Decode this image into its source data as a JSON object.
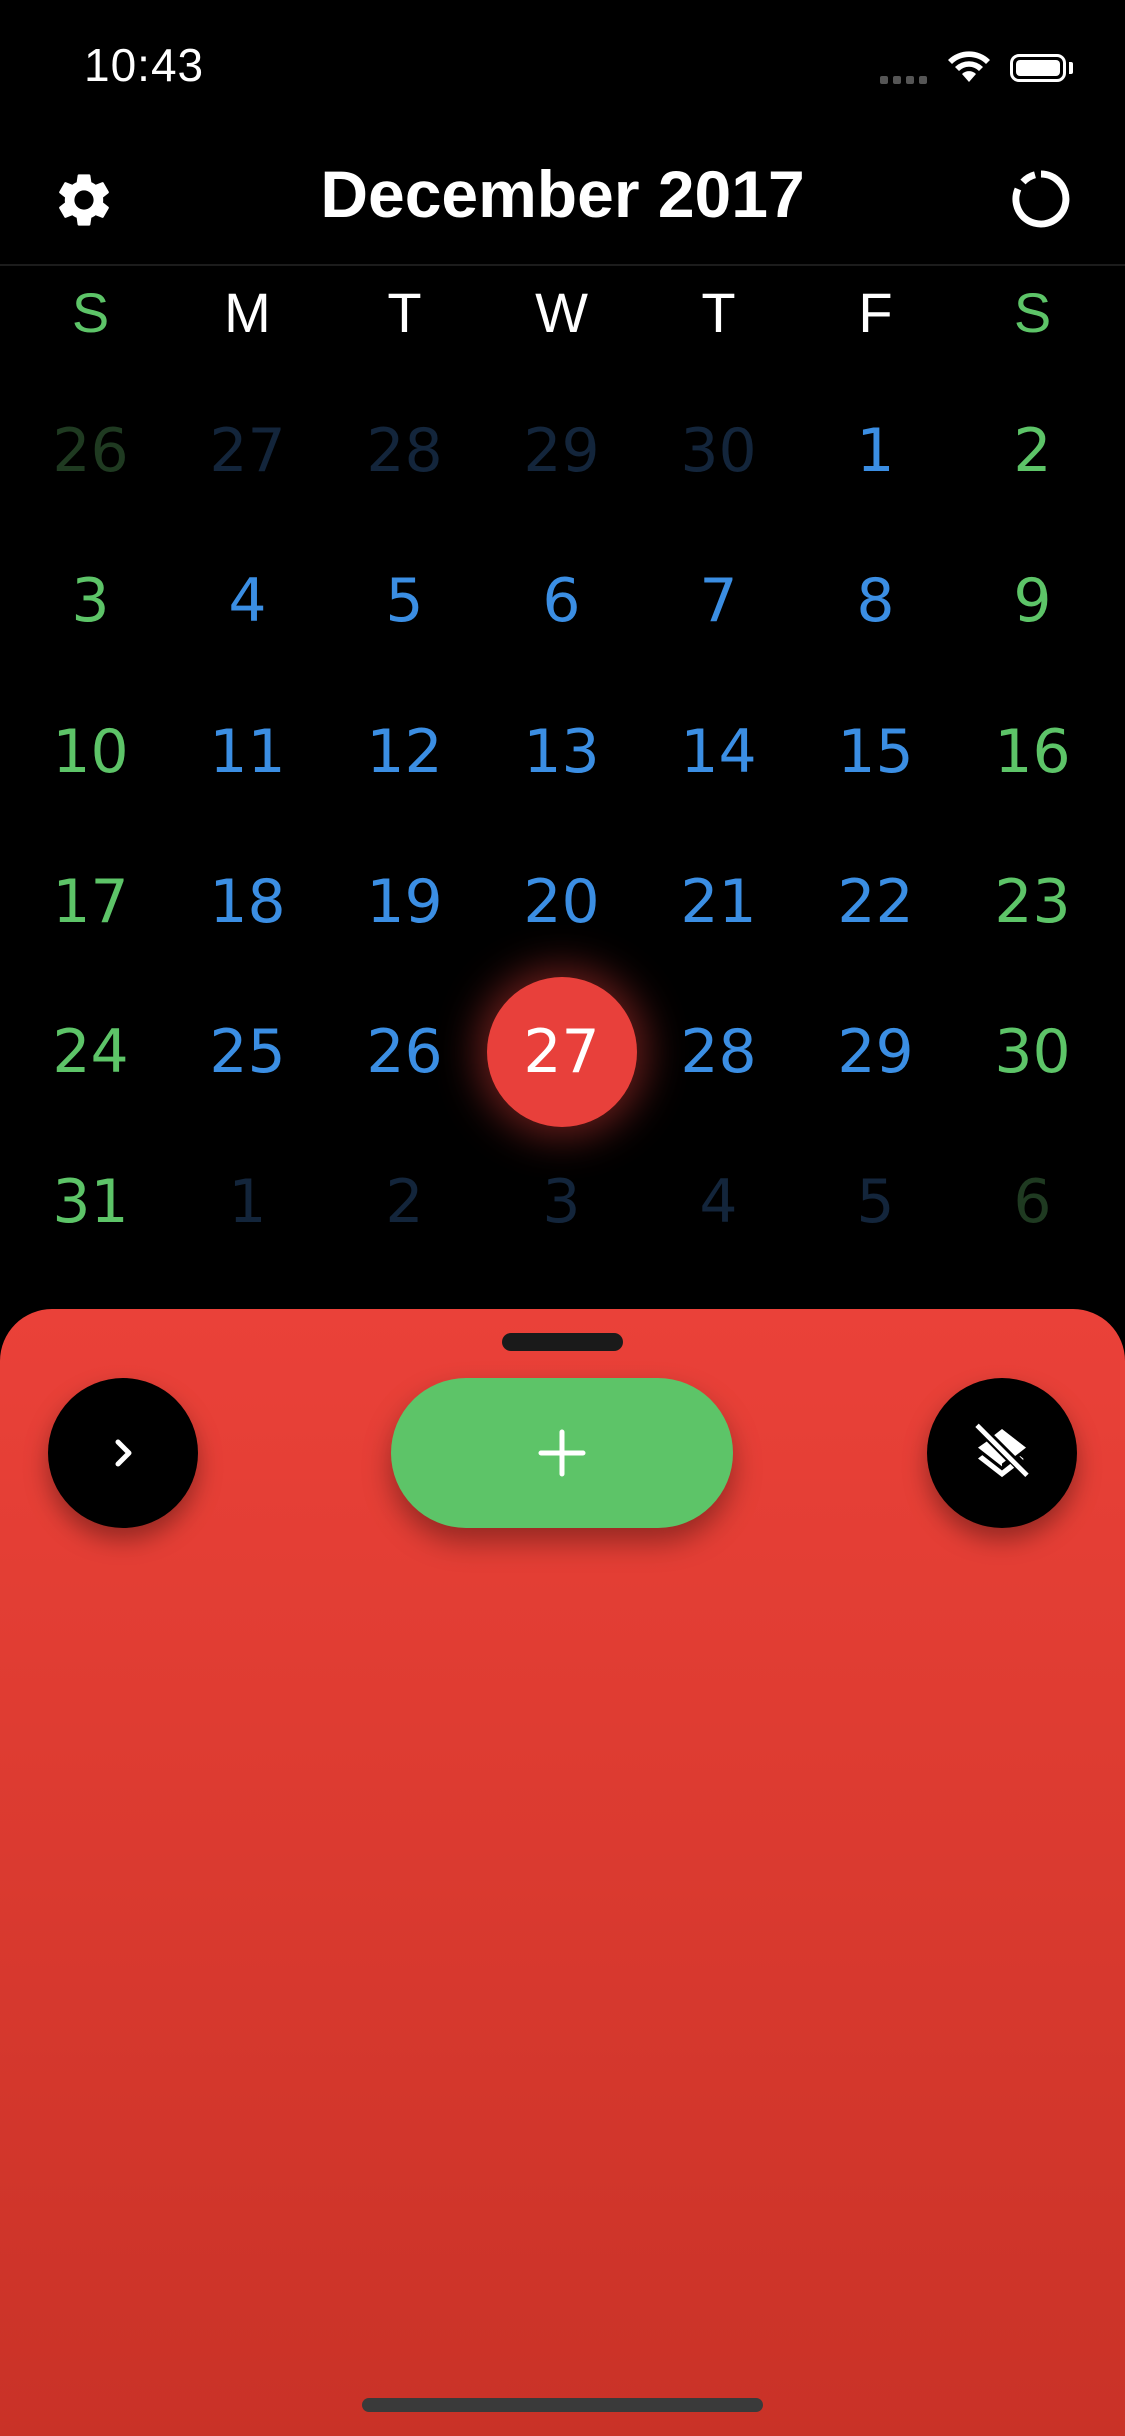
{
  "status_bar": {
    "time": "10:43"
  },
  "header": {
    "title": "December 2017",
    "left_icon": "gear-icon",
    "right_icon": "refresh-icon"
  },
  "weekdays": [
    "S",
    "M",
    "T",
    "W",
    "T",
    "F",
    "S"
  ],
  "colors": {
    "weekend": "#5dc468",
    "weekday_header": "#ffffff",
    "weekday": "#3b8ee3",
    "weekend_dim": "#1f3a21",
    "weekday_dim": "#13253b",
    "selected": "#e8403b",
    "add_button": "#5dc468",
    "sheet": "#e13d33"
  },
  "weeks": [
    [
      {
        "d": "26",
        "state": "dim"
      },
      {
        "d": "27",
        "state": "dim"
      },
      {
        "d": "28",
        "state": "dim"
      },
      {
        "d": "29",
        "state": "dim"
      },
      {
        "d": "30",
        "state": "dim"
      },
      {
        "d": "1",
        "state": "normal"
      },
      {
        "d": "2",
        "state": "normal"
      }
    ],
    [
      {
        "d": "3",
        "state": "normal"
      },
      {
        "d": "4",
        "state": "normal"
      },
      {
        "d": "5",
        "state": "normal"
      },
      {
        "d": "6",
        "state": "normal"
      },
      {
        "d": "7",
        "state": "normal"
      },
      {
        "d": "8",
        "state": "normal"
      },
      {
        "d": "9",
        "state": "normal"
      }
    ],
    [
      {
        "d": "10",
        "state": "normal"
      },
      {
        "d": "11",
        "state": "normal"
      },
      {
        "d": "12",
        "state": "normal"
      },
      {
        "d": "13",
        "state": "normal"
      },
      {
        "d": "14",
        "state": "normal"
      },
      {
        "d": "15",
        "state": "normal"
      },
      {
        "d": "16",
        "state": "normal"
      }
    ],
    [
      {
        "d": "17",
        "state": "normal"
      },
      {
        "d": "18",
        "state": "normal"
      },
      {
        "d": "19",
        "state": "normal"
      },
      {
        "d": "20",
        "state": "normal"
      },
      {
        "d": "21",
        "state": "normal"
      },
      {
        "d": "22",
        "state": "normal"
      },
      {
        "d": "23",
        "state": "normal"
      }
    ],
    [
      {
        "d": "24",
        "state": "normal"
      },
      {
        "d": "25",
        "state": "normal"
      },
      {
        "d": "26",
        "state": "normal"
      },
      {
        "d": "27",
        "state": "selected"
      },
      {
        "d": "28",
        "state": "normal"
      },
      {
        "d": "29",
        "state": "normal"
      },
      {
        "d": "30",
        "state": "normal"
      }
    ],
    [
      {
        "d": "31",
        "state": "normal"
      },
      {
        "d": "1",
        "state": "dim"
      },
      {
        "d": "2",
        "state": "dim"
      },
      {
        "d": "3",
        "state": "dim"
      },
      {
        "d": "4",
        "state": "dim"
      },
      {
        "d": "5",
        "state": "dim"
      },
      {
        "d": "6",
        "state": "dim"
      }
    ]
  ],
  "sheet": {
    "left_button_icon": "chevron-right-icon",
    "center_button_icon": "plus-icon",
    "right_button_icon": "layers-off-icon"
  }
}
